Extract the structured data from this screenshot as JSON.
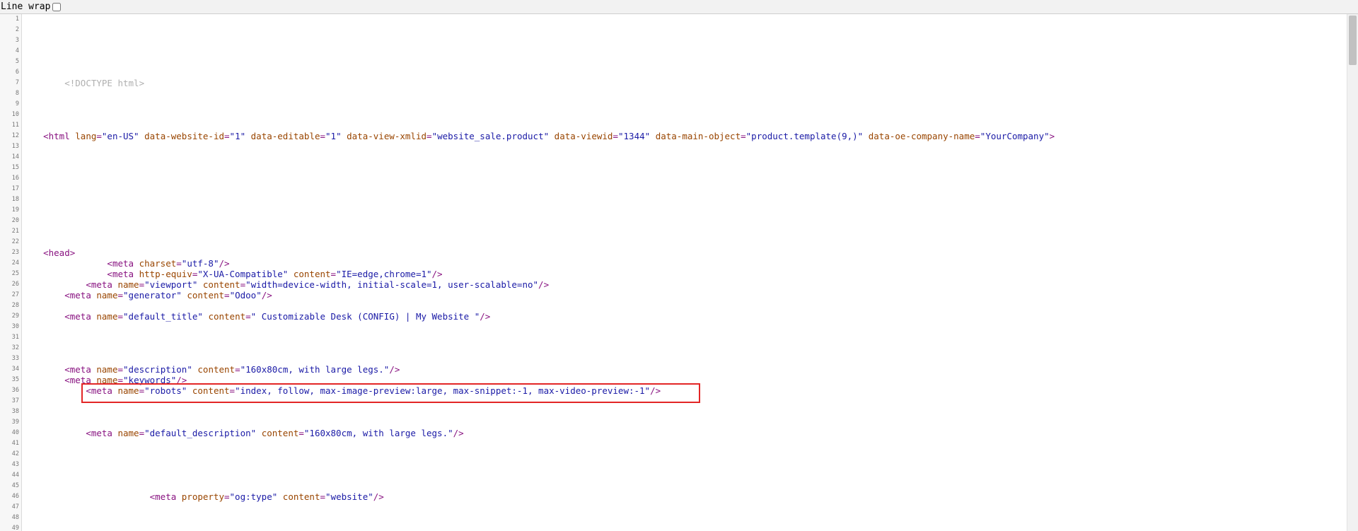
{
  "toolbar": {
    "line_wrap_label": "Line wrap",
    "line_wrap_checked": false
  },
  "code_lines": [
    {
      "n": "1",
      "indent": 0,
      "parts": []
    },
    {
      "n": "2",
      "indent": 0,
      "parts": []
    },
    {
      "n": "3",
      "indent": 0,
      "parts": []
    },
    {
      "n": "4",
      "indent": 0,
      "parts": []
    },
    {
      "n": "5",
      "indent": 0,
      "parts": []
    },
    {
      "n": "6",
      "indent": 0,
      "parts": []
    },
    {
      "n": "7",
      "indent": 8,
      "parts": [
        [
          "c",
          "<!DOCTYPE html>"
        ]
      ]
    },
    {
      "n": "8",
      "indent": 0,
      "parts": []
    },
    {
      "n": "9",
      "indent": 0,
      "parts": []
    },
    {
      "n": "10",
      "indent": 0,
      "parts": []
    },
    {
      "n": "11",
      "indent": 0,
      "parts": []
    },
    {
      "n": "12",
      "indent": 4,
      "parts": [
        [
          "t",
          "<html "
        ],
        [
          "a",
          "lang"
        ],
        [
          "t",
          "="
        ],
        [
          "v",
          "\"en-US\""
        ],
        [
          "t",
          " "
        ],
        [
          "a",
          "data-website-id"
        ],
        [
          "t",
          "="
        ],
        [
          "v",
          "\"1\""
        ],
        [
          "t",
          " "
        ],
        [
          "a",
          "data-editable"
        ],
        [
          "t",
          "="
        ],
        [
          "v",
          "\"1\""
        ],
        [
          "t",
          " "
        ],
        [
          "a",
          "data-view-xmlid"
        ],
        [
          "t",
          "="
        ],
        [
          "v",
          "\"website_sale.product\""
        ],
        [
          "t",
          " "
        ],
        [
          "a",
          "data-viewid"
        ],
        [
          "t",
          "="
        ],
        [
          "v",
          "\"1344\""
        ],
        [
          "t",
          " "
        ],
        [
          "a",
          "data-main-object"
        ],
        [
          "t",
          "="
        ],
        [
          "v",
          "\"product.template(9,)\""
        ],
        [
          "t",
          " "
        ],
        [
          "a",
          "data-oe-company-name"
        ],
        [
          "t",
          "="
        ],
        [
          "v",
          "\"YourCompany\""
        ],
        [
          "t",
          ">"
        ]
      ]
    },
    {
      "n": "13",
      "indent": 0,
      "parts": []
    },
    {
      "n": "14",
      "indent": 0,
      "parts": []
    },
    {
      "n": "15",
      "indent": 0,
      "parts": []
    },
    {
      "n": "16",
      "indent": 0,
      "parts": []
    },
    {
      "n": "17",
      "indent": 0,
      "parts": []
    },
    {
      "n": "18",
      "indent": 0,
      "parts": []
    },
    {
      "n": "19",
      "indent": 0,
      "parts": []
    },
    {
      "n": "20",
      "indent": 0,
      "parts": []
    },
    {
      "n": "21",
      "indent": 0,
      "parts": []
    },
    {
      "n": "22",
      "indent": 0,
      "parts": []
    },
    {
      "n": "23",
      "indent": 4,
      "parts": [
        [
          "t",
          "<head>"
        ]
      ]
    },
    {
      "n": "24",
      "indent": 16,
      "parts": [
        [
          "t",
          "<meta "
        ],
        [
          "a",
          "charset"
        ],
        [
          "t",
          "="
        ],
        [
          "v",
          "\"utf-8\""
        ],
        [
          "t",
          "/>"
        ]
      ]
    },
    {
      "n": "25",
      "indent": 16,
      "parts": [
        [
          "t",
          "<meta "
        ],
        [
          "a",
          "http-equiv"
        ],
        [
          "t",
          "="
        ],
        [
          "v",
          "\"X-UA-Compatible\""
        ],
        [
          "t",
          " "
        ],
        [
          "a",
          "content"
        ],
        [
          "t",
          "="
        ],
        [
          "v",
          "\"IE=edge,chrome=1\""
        ],
        [
          "t",
          "/>"
        ]
      ]
    },
    {
      "n": "26",
      "indent": 12,
      "parts": [
        [
          "t",
          "<meta "
        ],
        [
          "a",
          "name"
        ],
        [
          "t",
          "="
        ],
        [
          "v",
          "\"viewport\""
        ],
        [
          "t",
          " "
        ],
        [
          "a",
          "content"
        ],
        [
          "t",
          "="
        ],
        [
          "v",
          "\"width=device-width, initial-scale=1, user-scalable=no\""
        ],
        [
          "t",
          "/>"
        ]
      ]
    },
    {
      "n": "27",
      "indent": 8,
      "parts": [
        [
          "t",
          "<meta "
        ],
        [
          "a",
          "name"
        ],
        [
          "t",
          "="
        ],
        [
          "v",
          "\"generator\""
        ],
        [
          "t",
          " "
        ],
        [
          "a",
          "content"
        ],
        [
          "t",
          "="
        ],
        [
          "v",
          "\"Odoo\""
        ],
        [
          "t",
          "/>"
        ]
      ]
    },
    {
      "n": "28",
      "indent": 0,
      "parts": []
    },
    {
      "n": "29",
      "indent": 8,
      "parts": [
        [
          "t",
          "<meta "
        ],
        [
          "a",
          "name"
        ],
        [
          "t",
          "="
        ],
        [
          "v",
          "\"default_title\""
        ],
        [
          "t",
          " "
        ],
        [
          "a",
          "content"
        ],
        [
          "t",
          "="
        ],
        [
          "v",
          "\" Customizable Desk (CONFIG) | My Website \""
        ],
        [
          "t",
          "/>"
        ]
      ]
    },
    {
      "n": "30",
      "indent": 0,
      "parts": []
    },
    {
      "n": "31",
      "indent": 0,
      "parts": []
    },
    {
      "n": "32",
      "indent": 0,
      "parts": []
    },
    {
      "n": "33",
      "indent": 0,
      "parts": []
    },
    {
      "n": "34",
      "indent": 8,
      "parts": [
        [
          "t",
          "<meta "
        ],
        [
          "a",
          "name"
        ],
        [
          "t",
          "="
        ],
        [
          "v",
          "\"description\""
        ],
        [
          "t",
          " "
        ],
        [
          "a",
          "content"
        ],
        [
          "t",
          "="
        ],
        [
          "v",
          "\"160x80cm, with large legs.\""
        ],
        [
          "t",
          "/>"
        ]
      ]
    },
    {
      "n": "35",
      "indent": 8,
      "parts": [
        [
          "t",
          "<meta "
        ],
        [
          "a",
          "name"
        ],
        [
          "t",
          "="
        ],
        [
          "v",
          "\"keywords\""
        ],
        [
          "t",
          "/>"
        ]
      ]
    },
    {
      "n": "36",
      "indent": 12,
      "parts": [
        [
          "t",
          "<meta "
        ],
        [
          "a",
          "name"
        ],
        [
          "t",
          "="
        ],
        [
          "v",
          "\"robots\""
        ],
        [
          "t",
          " "
        ],
        [
          "a",
          "content"
        ],
        [
          "t",
          "="
        ],
        [
          "v",
          "\"index, follow, max-image-preview:large, max-snippet:-1, max-video-preview:-1\""
        ],
        [
          "t",
          "/>"
        ]
      ]
    },
    {
      "n": "37",
      "indent": 0,
      "parts": []
    },
    {
      "n": "38",
      "indent": 0,
      "parts": []
    },
    {
      "n": "39",
      "indent": 0,
      "parts": []
    },
    {
      "n": "40",
      "indent": 12,
      "parts": [
        [
          "t",
          "<meta "
        ],
        [
          "a",
          "name"
        ],
        [
          "t",
          "="
        ],
        [
          "v",
          "\"default_description\""
        ],
        [
          "t",
          " "
        ],
        [
          "a",
          "content"
        ],
        [
          "t",
          "="
        ],
        [
          "v",
          "\"160x80cm, with large legs.\""
        ],
        [
          "t",
          "/>"
        ]
      ]
    },
    {
      "n": "41",
      "indent": 0,
      "parts": []
    },
    {
      "n": "42",
      "indent": 0,
      "parts": []
    },
    {
      "n": "43",
      "indent": 0,
      "parts": []
    },
    {
      "n": "44",
      "indent": 0,
      "parts": []
    },
    {
      "n": "45",
      "indent": 0,
      "parts": []
    },
    {
      "n": "46",
      "indent": 24,
      "parts": [
        [
          "t",
          "<meta "
        ],
        [
          "a",
          "property"
        ],
        [
          "t",
          "="
        ],
        [
          "v",
          "\"og:type\""
        ],
        [
          "t",
          " "
        ],
        [
          "a",
          "content"
        ],
        [
          "t",
          "="
        ],
        [
          "v",
          "\"website\""
        ],
        [
          "t",
          "/>"
        ]
      ]
    },
    {
      "n": "47",
      "indent": 0,
      "parts": []
    },
    {
      "n": "48",
      "indent": 0,
      "parts": []
    },
    {
      "n": "49",
      "indent": 0,
      "parts": []
    }
  ],
  "colors": {
    "tag": "#881280",
    "attribute": "#994500",
    "value": "#1a1aa6",
    "doctype": "#b0b0b0",
    "highlight_border": "#e32626"
  }
}
